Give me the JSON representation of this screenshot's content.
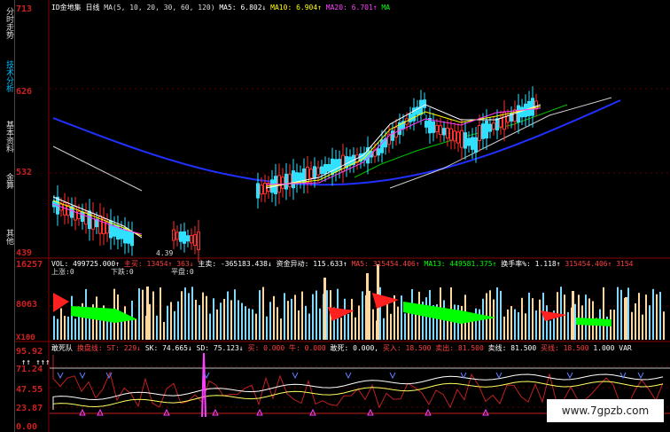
{
  "side_tabs": [
    "分时走势",
    "技术分析",
    "基本资料",
    "金算",
    "其他"
  ],
  "price_axis": [
    "713",
    "626",
    "532",
    "439"
  ],
  "main_header": {
    "title": "ID金地集",
    "period": "日线",
    "ma_params": "MA(5, 10, 20, 30, 60, 120)",
    "ma5": "MA5: 6.802↓",
    "ma10": "MA10: 6.904↑",
    "ma20": "MA20: 6.701↑",
    "tail": "MA"
  },
  "low_price_label": "4.39",
  "volume_header": {
    "vol": "VOL: 499725.000↑",
    "zhumai": "主买: 13454↑",
    "n363": "363↓",
    "zhumai2": "主卖: -365183.438↓",
    "zijin": "资金异动: 115.633↑",
    "ma5": "MA5: 315454.406↑",
    "ma13": "MA13: 449581.375↑",
    "turnover": "换手率%: 1.118↑",
    "tail1": "315454.406↑",
    "tail2": "3154"
  },
  "vol_axis": [
    "16257",
    "8063",
    "X100"
  ],
  "vol_sub": {
    "up": "上涨:0",
    "down": "下跌:0",
    "flat": "平盘:0"
  },
  "indicator_header": {
    "title": "敢死队",
    "huanpan": "换盘线: ST: 229↓",
    "sk": "SK: 74.665↓",
    "sd": "SD: 75.123↓",
    "mai": "买: 0.000",
    "niu": "牛: 0.000",
    "gansi": "敢死: 0.000,",
    "mairu": "买入: 18.500",
    "maichu": "卖出: 81.500",
    "maixian": "卖线: 81.500",
    "mairuxian": "买线: 18.500",
    "one": "1.000",
    "var": "VAR"
  },
  "ind_axis": [
    "95.92",
    "71.24",
    "47.55",
    "23.87",
    "0.00"
  ],
  "ind_arrows": "↑↑ ↑↑↑",
  "watermark": "www.7gpzb.com"
}
